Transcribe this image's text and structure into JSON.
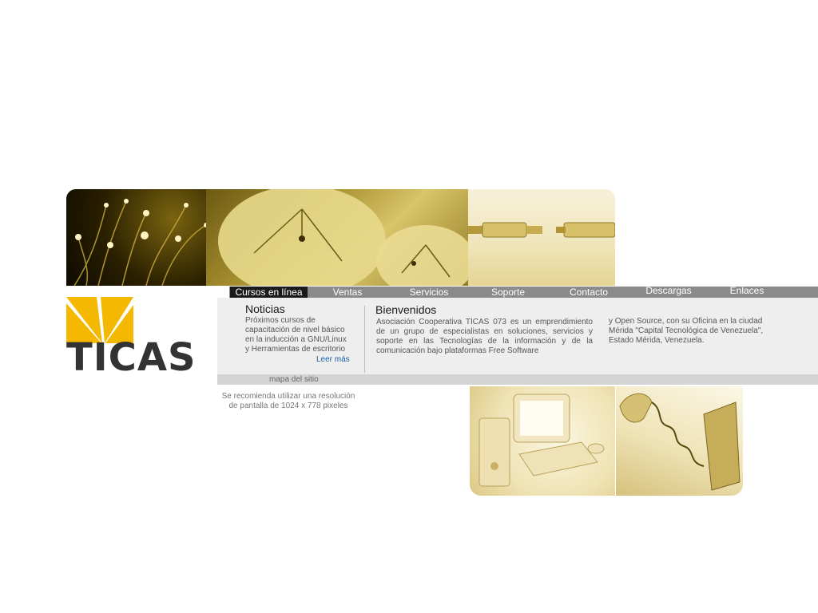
{
  "nav": {
    "items": [
      "Cursos en línea",
      "Ventas",
      "Servicios",
      "Soporte",
      "Contacto",
      "Descargas",
      "Enlaces"
    ]
  },
  "logo": {
    "text": "TICAS"
  },
  "news": {
    "title": "Noticias",
    "body": "Próximos cursos de capacitación de nivel básico en la inducción a GNU/Linux y Herramientas de escritorio",
    "read_more": "Leer más"
  },
  "welcome": {
    "title": "Bienvenidos",
    "col1": "Asociación Cooperativa TICAS 073 es un emprendimiento de un grupo de especialistas en soluciones, servicios y soporte en las Tecnologías de la información y de la comunicación bajo plataformas Free Software",
    "col2": "y Open Source, con su Oficina en la ciudad Mérida \"Capital Tecnológica de Venezuela\", Estado Mérida, Venezuela."
  },
  "footer": {
    "site_map": "mapa del sitio",
    "resolution_note": "Se recomienda utilizar una resolución de pantalla de 1024 x 778 pixeles"
  },
  "colors": {
    "brand_yellow": "#f5b800",
    "logo_text": "#333333",
    "nav_bg": "#8a8a8a",
    "nav_active_bg": "#1a1a1a",
    "link": "#1a5fa8"
  }
}
